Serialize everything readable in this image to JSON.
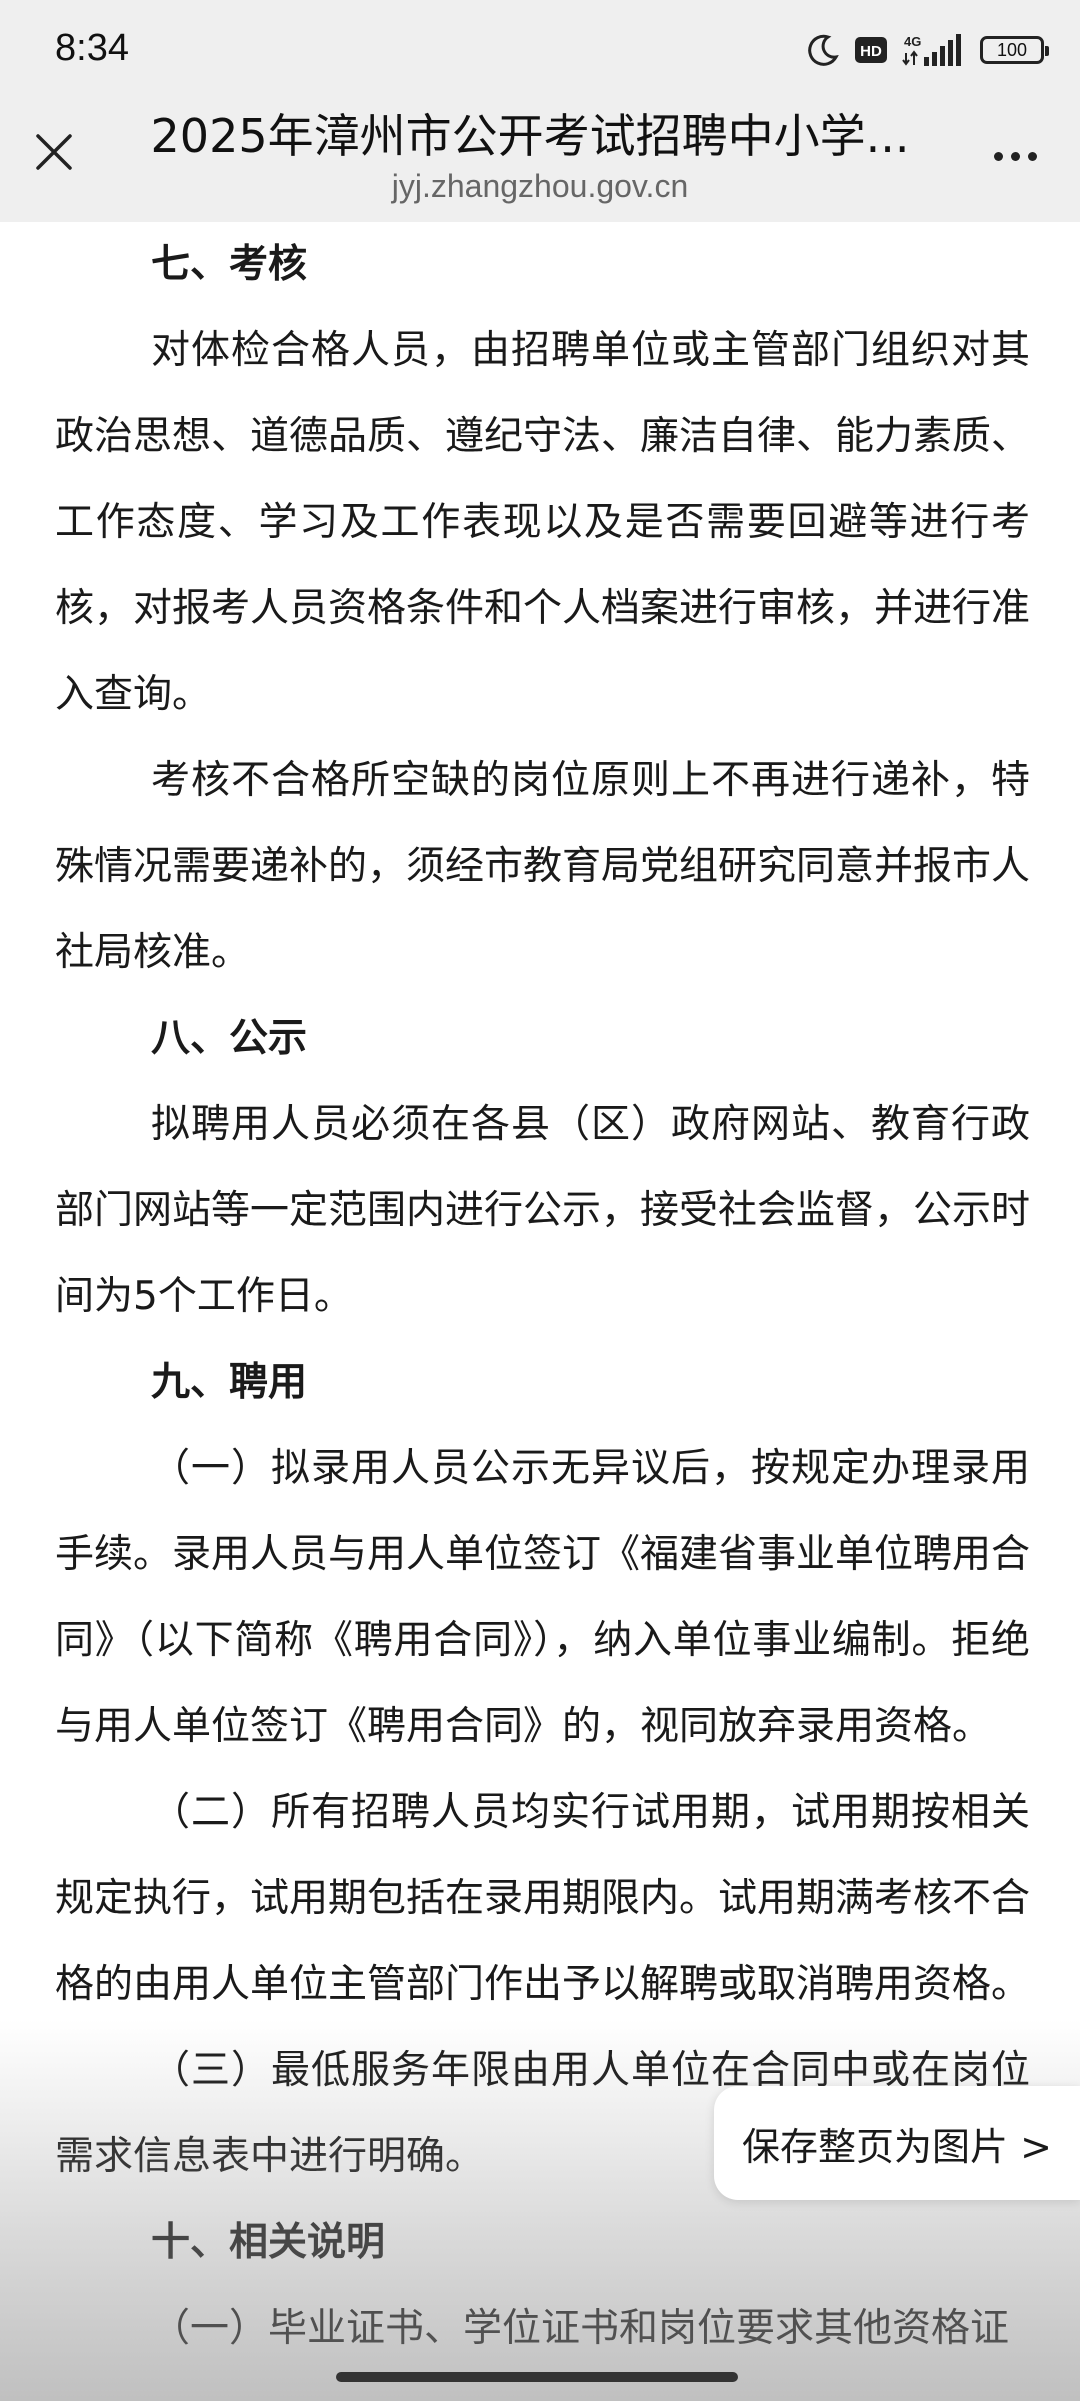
{
  "status_bar": {
    "time": "8:34",
    "icons": [
      "moon-icon",
      "hd-icon",
      "4g-signal-icon",
      "battery-icon"
    ],
    "hd_label": "HD",
    "network_label": "4G",
    "battery_level": "100"
  },
  "title_bar": {
    "title": "2025年漳州市公开考试招聘中小学...",
    "domain": "jyj.zhangzhou.gov.cn"
  },
  "article": {
    "blocks": [
      {
        "type": "heading",
        "text": "七、考核"
      },
      {
        "type": "para",
        "text": "对体检合格人员，由招聘单位或主管部门组织对其政治思想、道德品质、遵纪守法、廉洁自律、能力素质、工作态度、学习及工作表现以及是否需要回避等进行考核，对报考人员资格条件和个人档案进行审核，并进行准入查询。"
      },
      {
        "type": "para",
        "text": "考核不合格所空缺的岗位原则上不再进行递补，特殊情况需要递补的，须经市教育局党组研究同意并报市人社局核准。"
      },
      {
        "type": "heading",
        "text": "八、公示"
      },
      {
        "type": "para",
        "text": "拟聘用人员必须在各县（区）政府网站、教育行政部门网站等一定范围内进行公示，接受社会监督，公示时间为5个工作日。"
      },
      {
        "type": "heading",
        "text": "九、聘用"
      },
      {
        "type": "para",
        "text": "（一）拟录用人员公示无异议后，按规定办理录用手续。录用人员与用人单位签订《福建省事业单位聘用合同》（以下简称《聘用合同》），纳入单位事业编制。拒绝与用人单位签订《聘用合同》的，视同放弃录用资格。"
      },
      {
        "type": "para",
        "text": "（二）所有招聘人员均实行试用期，试用期按相关规定执行，试用期包括在录用期限内。试用期满考核不合格的由用人单位主管部门作出予以解聘或取消聘用资格。"
      },
      {
        "type": "para",
        "text": "（三）最低服务年限由用人单位在合同中或在岗位需求信息表中进行明确。"
      },
      {
        "type": "heading",
        "text": "十、相关说明"
      },
      {
        "type": "para",
        "text": "（一）毕业证书、学位证书和岗位要求其他资格证"
      }
    ]
  },
  "floating_button": {
    "label": "保存整页为图片 >"
  }
}
